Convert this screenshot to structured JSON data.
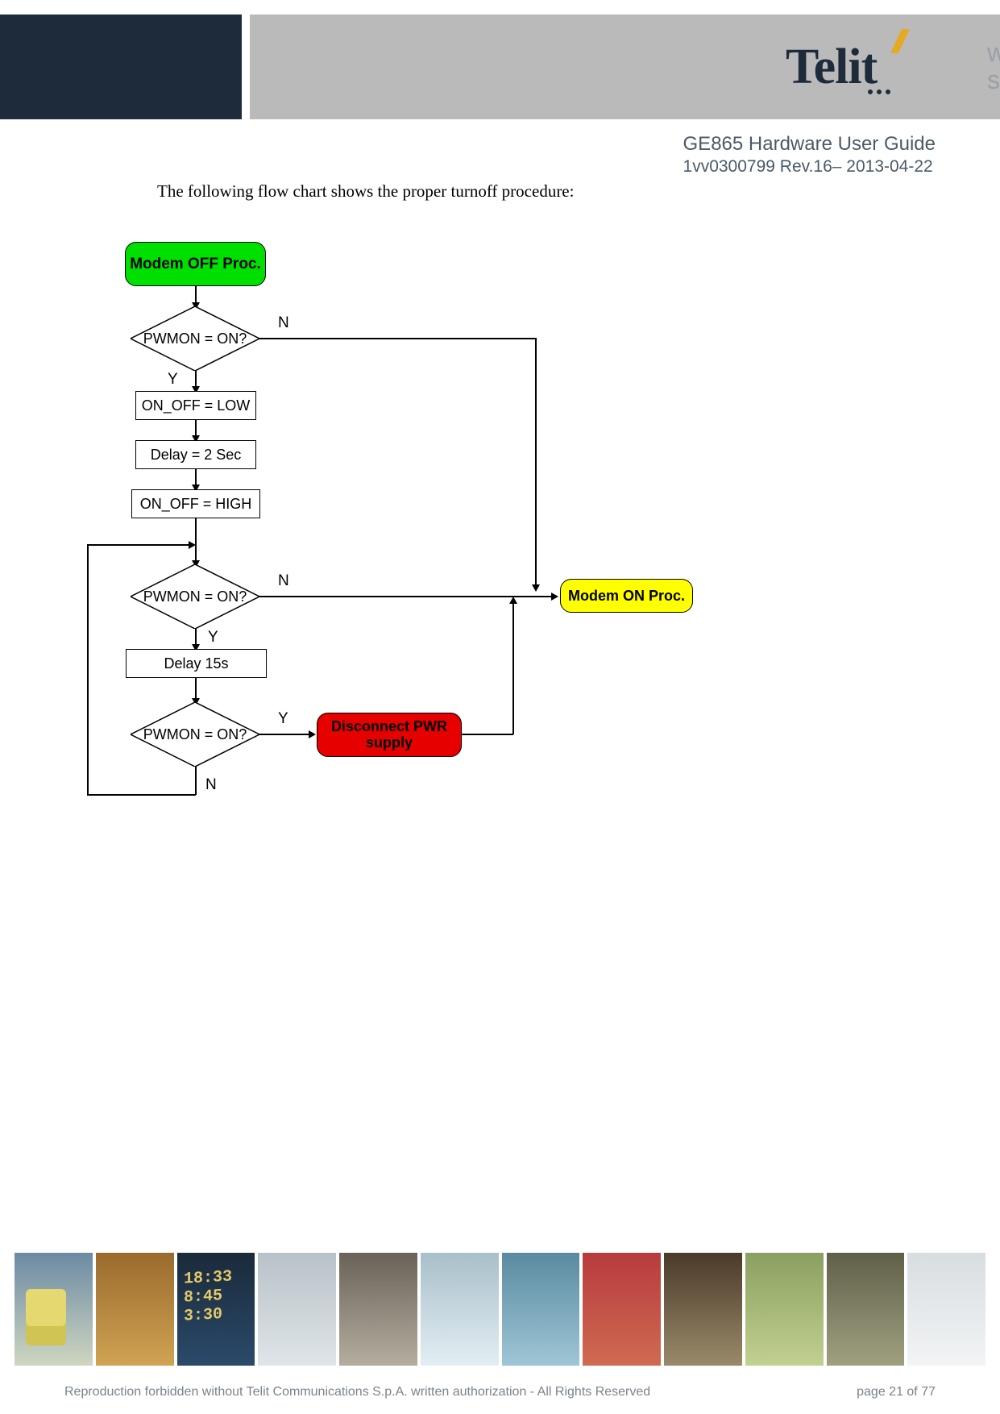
{
  "header": {
    "brand": "Telit",
    "tagline_line1": "wireless",
    "tagline_line2": "solutions"
  },
  "doc": {
    "title": "GE865 Hardware User Guide",
    "rev": "1vv0300799 Rev.16– 2013-04-22"
  },
  "intro": "The following flow chart shows the proper turnoff procedure:",
  "chart_data": {
    "type": "flowchart",
    "nodes": [
      {
        "id": "start",
        "type": "terminator",
        "label": "Modem OFF Proc.",
        "fill": "#00e000"
      },
      {
        "id": "d1",
        "type": "decision",
        "label": "PWMON = ON?"
      },
      {
        "id": "p1",
        "type": "process",
        "label": "ON_OFF = LOW"
      },
      {
        "id": "p2",
        "type": "process",
        "label": "Delay = 2 Sec"
      },
      {
        "id": "p3",
        "type": "process",
        "label": "ON_OFF = HIGH"
      },
      {
        "id": "d2",
        "type": "decision",
        "label": "PWMON = ON?"
      },
      {
        "id": "p4",
        "type": "process",
        "label": "Delay 15s"
      },
      {
        "id": "d3",
        "type": "decision",
        "label": "PWMON = ON?"
      },
      {
        "id": "pwr",
        "type": "terminator",
        "label": "Disconnect  PWR supply",
        "fill": "#e60000"
      },
      {
        "id": "on",
        "type": "terminator",
        "label": "Modem ON Proc.",
        "fill": "#ffff00"
      }
    ],
    "edges": [
      {
        "from": "start",
        "to": "d1"
      },
      {
        "from": "d1",
        "to": "p1",
        "label": "Y"
      },
      {
        "from": "d1",
        "to": "on",
        "label": "N"
      },
      {
        "from": "p1",
        "to": "p2"
      },
      {
        "from": "p2",
        "to": "p3"
      },
      {
        "from": "p3",
        "to": "d2"
      },
      {
        "from": "d2",
        "to": "p4",
        "label": "Y"
      },
      {
        "from": "d2",
        "to": "on",
        "label": "N"
      },
      {
        "from": "p4",
        "to": "d3"
      },
      {
        "from": "d3",
        "to": "pwr",
        "label": "Y"
      },
      {
        "from": "d3",
        "to": "d2",
        "label": "N",
        "note": "loop back above d2"
      },
      {
        "from": "pwr",
        "to": "on"
      }
    ]
  },
  "nodes": {
    "start": "Modem OFF Proc.",
    "d1": "PWMON = ON?",
    "p1": "ON_OFF = LOW",
    "p2": "Delay = 2 Sec",
    "p3": "ON_OFF = HIGH",
    "d2": "PWMON = ON?",
    "p4": "Delay 15s",
    "d3": "PWMON = ON?",
    "pwr_l1": "Disconnect  PWR",
    "pwr_l2": "supply",
    "on": "Modem ON Proc."
  },
  "labels": {
    "Y": "Y",
    "N": "N"
  },
  "footer": {
    "copyright": "Reproduction forbidden without Telit Communications S.p.A. written authorization - All Rights Reserved",
    "page": "page 21 of 77"
  }
}
